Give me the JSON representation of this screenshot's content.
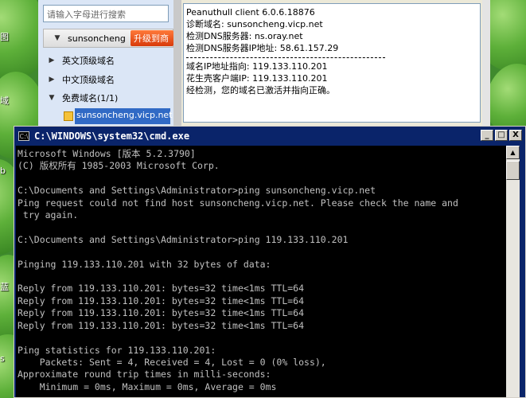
{
  "client": {
    "search_placeholder": "请输入字母进行搜索",
    "account": "sunsoncheng",
    "upgrade_label": "升级到商",
    "tree": [
      {
        "label": "英文顶级域名"
      },
      {
        "label": "中文顶级域名"
      },
      {
        "label": "免费域名(1/1)"
      }
    ],
    "selected_domain": "sunsoncheng.vicp.net",
    "diagnostics": [
      "Peanuthull client 6.0.6.18876",
      "诊断域名: sunsoncheng.vicp.net",
      "检测DNS服务器: ns.oray.net",
      "检测DNS服务器IP地址: 58.61.157.29",
      "域名IP地址指向: 119.133.110.201",
      "花生壳客户端IP: 119.133.110.201",
      "经检测，您的域名已激活并指向正确。"
    ]
  },
  "cmd": {
    "title": "C:\\WINDOWS\\system32\\cmd.exe",
    "controls": {
      "minimize": "_",
      "maximize": "□",
      "close": "X"
    },
    "lines": [
      "Microsoft Windows [版本 5.2.3790]",
      "(C) 版权所有 1985-2003 Microsoft Corp.",
      "",
      "C:\\Documents and Settings\\Administrator>ping sunsoncheng.vicp.net",
      "Ping request could not find host sunsoncheng.vicp.net. Please check the name and",
      " try again.",
      "",
      "C:\\Documents and Settings\\Administrator>ping 119.133.110.201",
      "",
      "Pinging 119.133.110.201 with 32 bytes of data:",
      "",
      "Reply from 119.133.110.201: bytes=32 time<1ms TTL=64",
      "Reply from 119.133.110.201: bytes=32 time<1ms TTL=64",
      "Reply from 119.133.110.201: bytes=32 time<1ms TTL=64",
      "Reply from 119.133.110.201: bytes=32 time<1ms TTL=64",
      "",
      "Ping statistics for 119.133.110.201:",
      "    Packets: Sent = 4, Received = 4, Lost = 0 (0% loss),",
      "Approximate round trip times in milli-seconds:",
      "    Minimum = 0ms, Maximum = 0ms, Average = 0ms"
    ]
  },
  "desktop": {
    "icon_labels": [
      "图",
      "域",
      "b",
      "蓝",
      "s"
    ]
  },
  "colors": {
    "console_bg": "#000000",
    "console_fg": "#c0c0c0",
    "title_bar": "#0a246a",
    "selection": "#316ac5",
    "upgrade": "#e2511a"
  }
}
